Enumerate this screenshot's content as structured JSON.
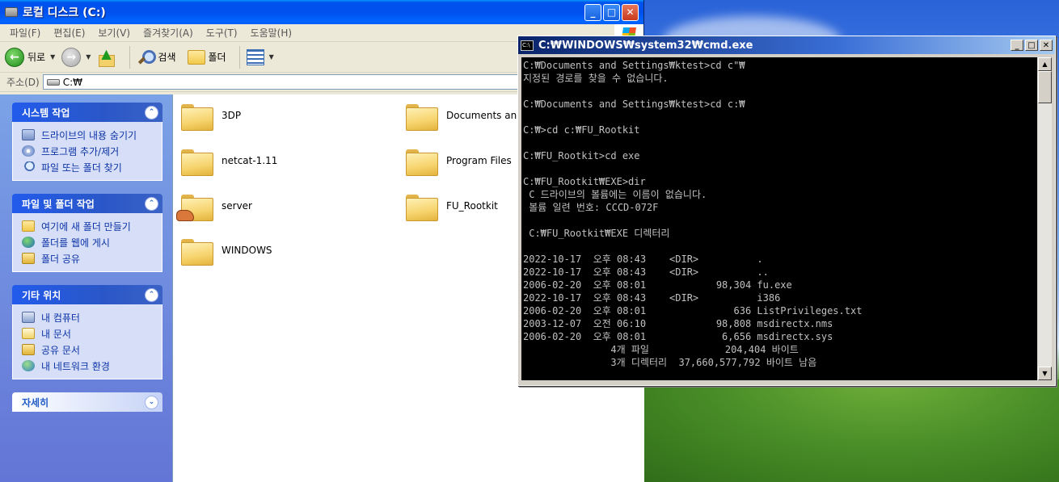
{
  "explorer": {
    "title": "로컬 디스크 (C:)",
    "menu": [
      "파일(F)",
      "편집(E)",
      "보기(V)",
      "즐겨찾기(A)",
      "도구(T)",
      "도움말(H)"
    ],
    "toolbar": {
      "back": "뒤로",
      "search": "검색",
      "folders": "폴더"
    },
    "address": {
      "label": "주소(D)",
      "value": "C:₩"
    },
    "panels": [
      {
        "title": "시스템 작업",
        "items": [
          "드라이브의 내용 숨기기",
          "프로그램 추가/제거",
          "파일 또는 폴더 찾기"
        ]
      },
      {
        "title": "파일 및 폴더 작업",
        "items": [
          "여기에 새 폴더 만들기",
          "폴더를 웹에 게시",
          "폴더 공유"
        ]
      },
      {
        "title": "기타 위치",
        "items": [
          "내 컴퓨터",
          "내 문서",
          "공유 문서",
          "내 네트워크 환경"
        ]
      },
      {
        "title": "자세히",
        "items": []
      }
    ],
    "folders": [
      "3DP",
      "Documents and",
      "netcat-1.11",
      "Program Files",
      "server",
      "FU_Rootkit",
      "WINDOWS"
    ]
  },
  "cmd": {
    "title": "C:₩WINDOWS₩system32₩cmd.exe",
    "lines": [
      "C:₩Documents and Settings₩ktest>cd c\"₩",
      "지정된 경로를 찾을 수 없습니다.",
      "",
      "C:₩Documents and Settings₩ktest>cd c:₩",
      "",
      "C:₩>cd c:₩FU_Rootkit",
      "",
      "C:₩FU_Rootkit>cd exe",
      "",
      "C:₩FU_Rootkit₩EXE>dir",
      " C 드라이브의 볼륨에는 이름이 없습니다.",
      " 볼륨 일련 번호: CCCD-072F",
      "",
      " C:₩FU_Rootkit₩EXE 디렉터리",
      "",
      "2022-10-17  오후 08:43    <DIR>          .",
      "2022-10-17  오후 08:43    <DIR>          ..",
      "2006-02-20  오후 08:01            98,304 fu.exe",
      "2022-10-17  오후 08:43    <DIR>          i386",
      "2006-02-20  오후 08:01               636 ListPrivileges.txt",
      "2003-12-07  오전 06:10            98,808 msdirectx.nms",
      "2006-02-20  오후 08:01             6,656 msdirectx.sys",
      "               4개 파일             204,404 바이트",
      "               3개 디렉터리  37,660,577,792 바이트 남음"
    ]
  }
}
